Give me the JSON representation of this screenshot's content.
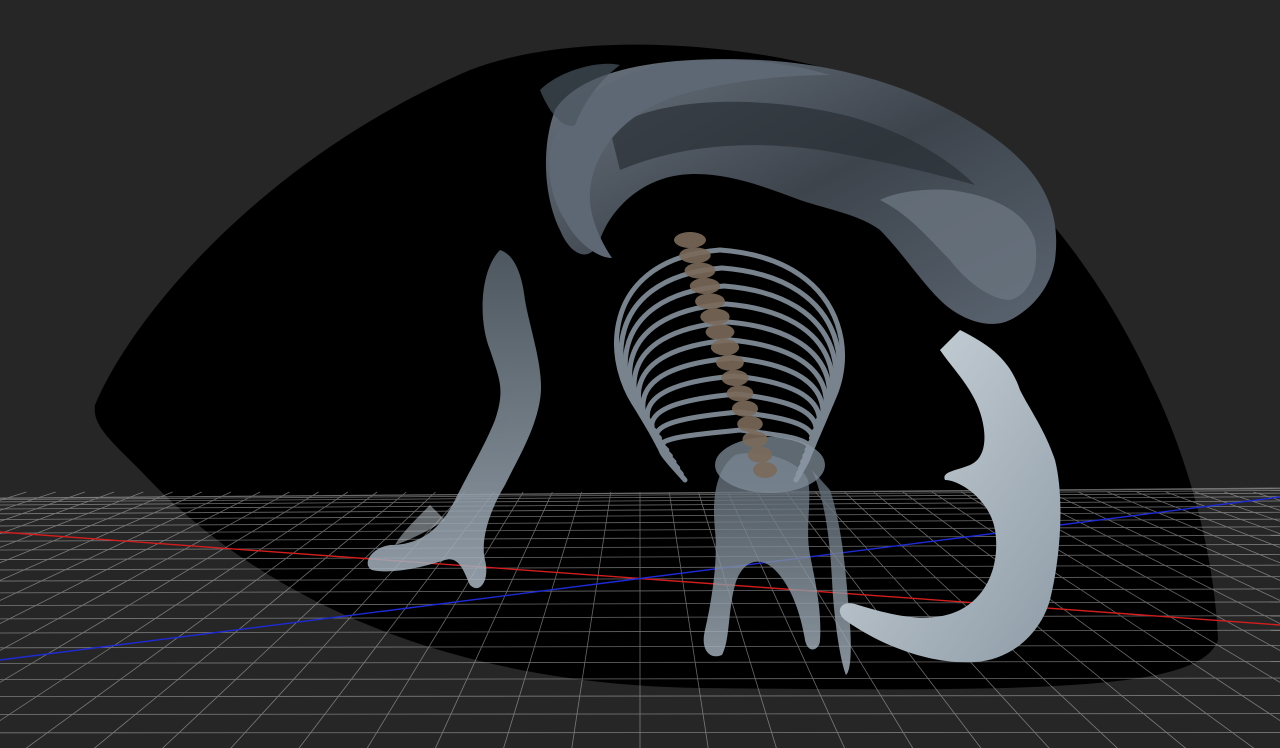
{
  "viewport": {
    "background_color": "#262626",
    "dome_color": "#000000",
    "grid_color": "#bfbfbf",
    "x_axis_color": "#d21e1e",
    "z_axis_color": "#1e2ad8",
    "model_color": "#8796a6",
    "model_highlight_color": "#c9d3dc",
    "tusk_color": "#b9c4cb"
  },
  "model": {
    "subject": "mammoth-skeleton",
    "parts": [
      "skull",
      "tusk-left",
      "tusk-right",
      "spine",
      "ribcage",
      "front-leg",
      "hind-leg",
      "pelvis"
    ]
  }
}
